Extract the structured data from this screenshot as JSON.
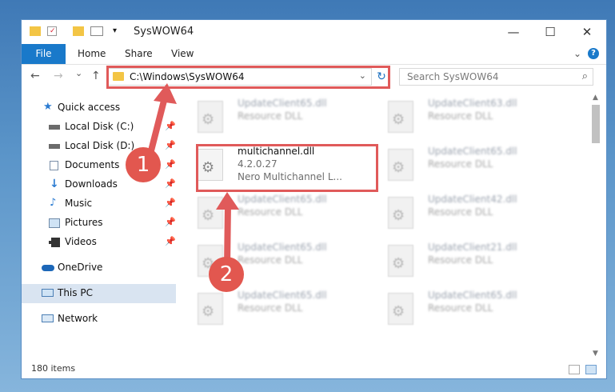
{
  "window": {
    "title": "SysWOW64",
    "minimize": "—",
    "maximize": "☐",
    "close": "✕"
  },
  "ribbon": {
    "file": "File",
    "tabs": [
      "Home",
      "Share",
      "View"
    ],
    "help": "?"
  },
  "nav": {
    "back": "←",
    "forward": "→",
    "recent": "⌄",
    "up": "↑",
    "address": "C:\\Windows\\SysWOW64",
    "refresh": "↻",
    "search_placeholder": "Search SysWOW64"
  },
  "sidebar": {
    "quick_access": "Quick access",
    "items": [
      {
        "label": "Local Disk (C:)",
        "pinned": true
      },
      {
        "label": "Local Disk (D:)",
        "pinned": true
      },
      {
        "label": "Documents",
        "pinned": true
      },
      {
        "label": "Downloads",
        "pinned": true
      },
      {
        "label": "Music",
        "pinned": true
      },
      {
        "label": "Pictures",
        "pinned": true
      },
      {
        "label": "Videos",
        "pinned": true
      }
    ],
    "onedrive": "OneDrive",
    "this_pc": "This PC",
    "network": "Network"
  },
  "files": {
    "col1": [
      {
        "name": "UpdateClient65.dll",
        "desc": "Resource DLL"
      },
      {
        "name": "multichannel.dll",
        "version": "4.2.0.27",
        "desc": "Nero Multichannel L..."
      },
      {
        "name": "UpdateClient65.dll",
        "desc": "Resource DLL"
      },
      {
        "name": "UpdateClient65.dll",
        "desc": "Resource DLL"
      },
      {
        "name": "UpdateClient65.dll",
        "desc": "Resource DLL"
      }
    ],
    "col2": [
      {
        "name": "UpdateClient63.dll",
        "desc": "Resource DLL"
      },
      {
        "name": "UpdateClient65.dll",
        "desc": "Resource DLL"
      },
      {
        "name": "UpdateClient42.dll",
        "desc": "Resource DLL"
      },
      {
        "name": "UpdateClient21.dll",
        "desc": "Resource DLL"
      },
      {
        "name": "UpdateClient65.dll",
        "desc": "Resource DLL"
      }
    ]
  },
  "status": {
    "count": "180 items"
  },
  "annotations": {
    "step1": "1",
    "step2": "2",
    "color": "#e05a5a"
  }
}
